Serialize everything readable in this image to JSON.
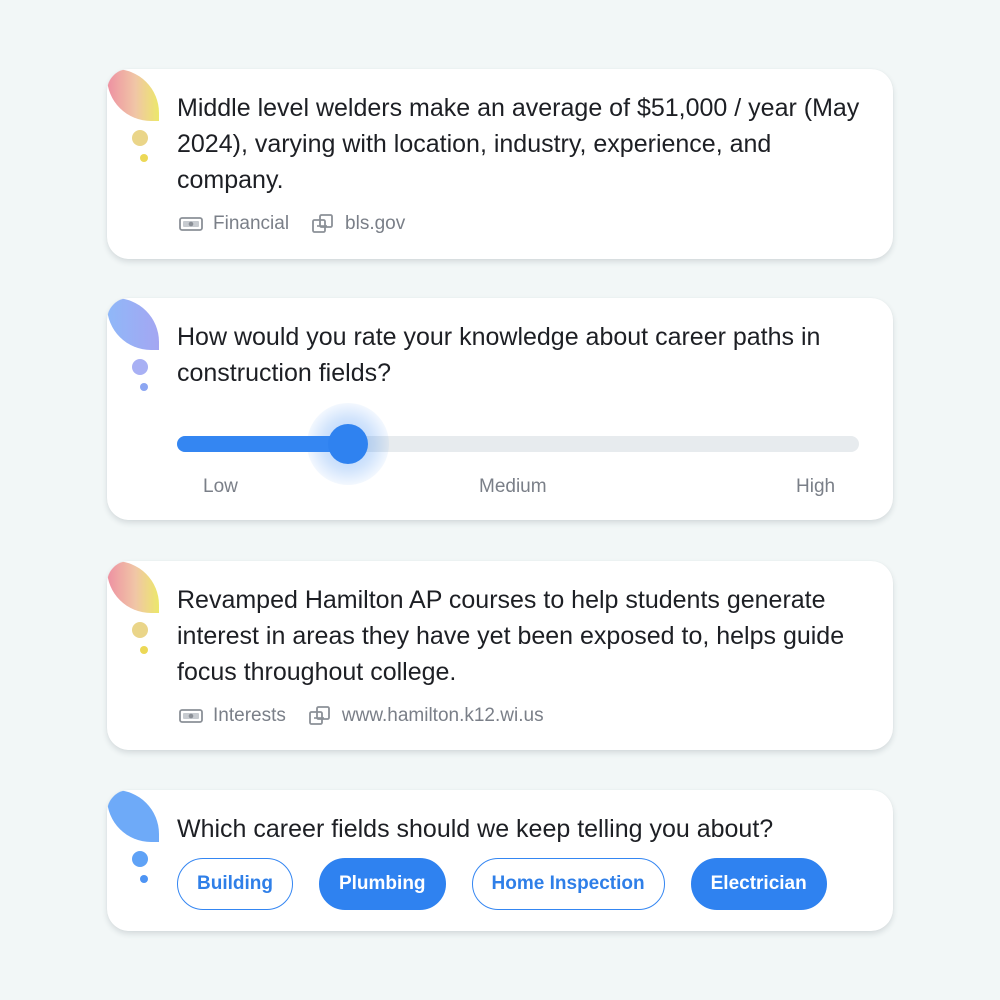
{
  "cards": [
    {
      "text": "Middle level welders make an average of $51,000 / year (May 2024), varying with location, industry, experience, and company.",
      "category_icon": "money-icon",
      "category": "Financial",
      "source_icon": "link-icon",
      "source": "bls.gov"
    },
    {
      "question": "How would you rate your knowledge about career paths in construction fields?",
      "slider": {
        "value_fraction": 0.25,
        "labels": [
          "Low",
          "Medium",
          "High"
        ]
      }
    },
    {
      "text": "Revamped Hamilton AP courses to help students generate interest in areas they have yet been exposed to, helps guide focus throughout college.",
      "category_icon": "money-icon",
      "category": "Interests",
      "source_icon": "link-icon",
      "source": "www.hamilton.k12.wi.us"
    },
    {
      "question": "Which career fields should we keep telling you about?",
      "chips": [
        {
          "label": "Building",
          "selected": false
        },
        {
          "label": "Plumbing",
          "selected": true
        },
        {
          "label": "Home Inspection",
          "selected": false
        },
        {
          "label": "Electrician",
          "selected": true
        }
      ]
    }
  ],
  "colors": {
    "accent": "#2f82f0",
    "background": "#f2f7f7",
    "muted_text": "#7a7f88"
  }
}
